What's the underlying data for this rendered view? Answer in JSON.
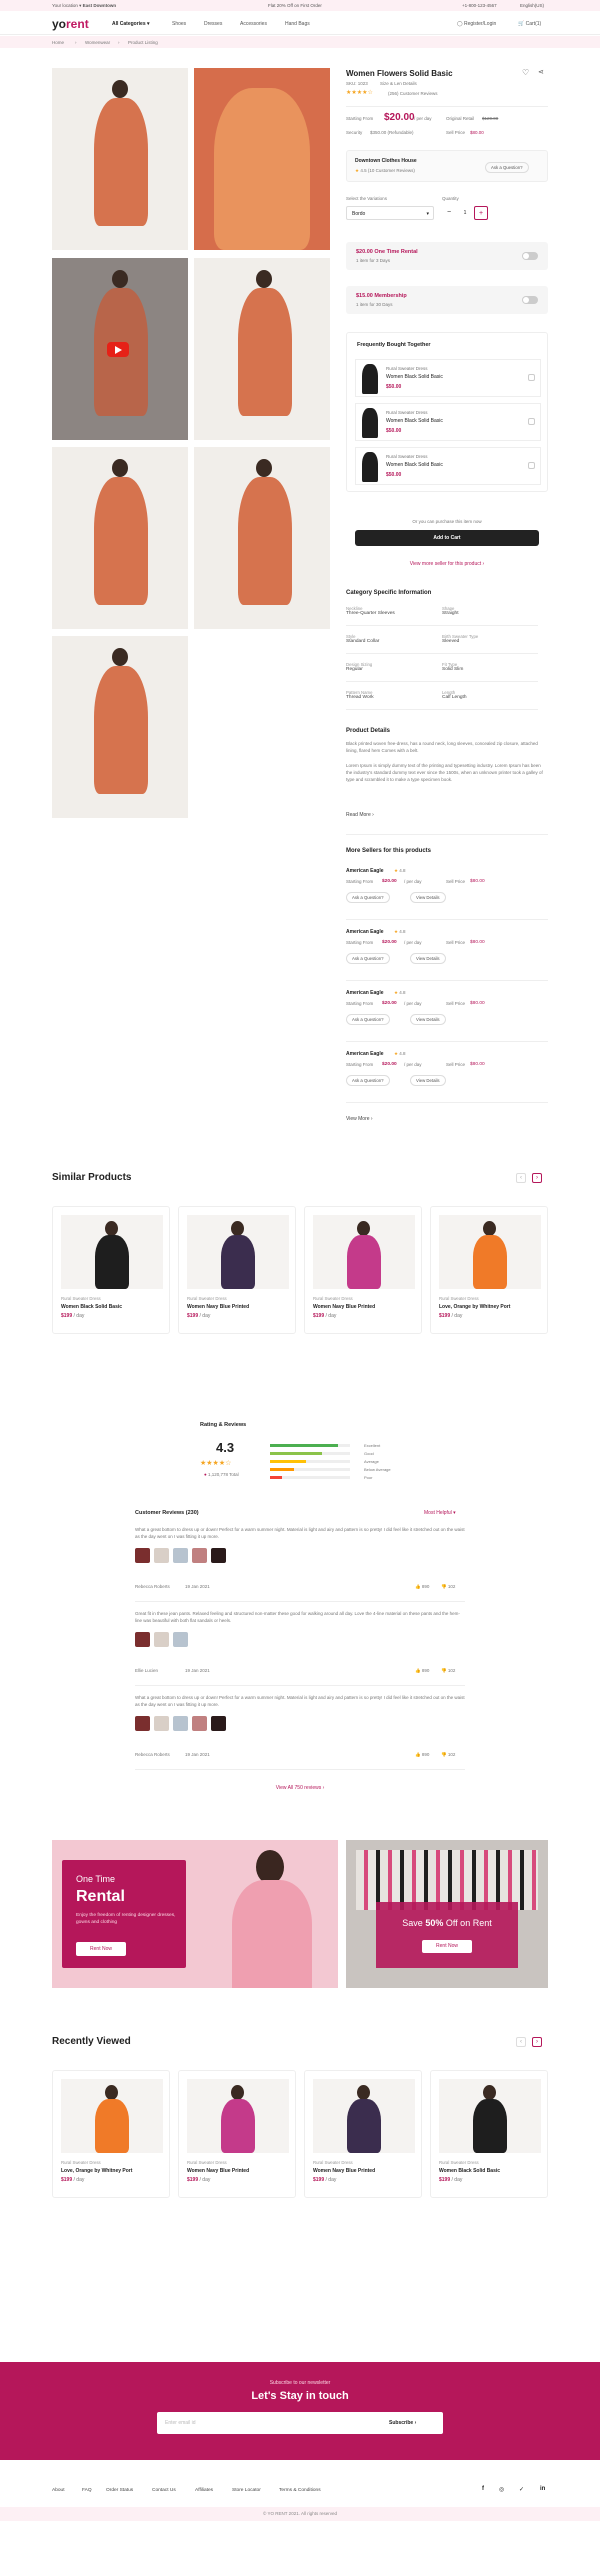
{
  "topbar": {
    "location_label": "Your location",
    "location_value": "East Downtown",
    "promo": "Flat 20% Off on First Order",
    "phone": "+1-800-123-4567",
    "language": "English(US)"
  },
  "header": {
    "logo_a": "yo",
    "logo_b": "rent",
    "categories_label": "All Categories",
    "nav": [
      "Shoes",
      "Dresses",
      "Accessories",
      "Hand Bags"
    ],
    "account": "Register/Login",
    "cart": "Cart(1)"
  },
  "breadcrumb": [
    "Home",
    "Womenwear",
    "Product Listing"
  ],
  "product": {
    "title": "Women Flowers Solid Basic",
    "sku": "SKU: 1023",
    "size": "Size & Len Details",
    "reviews": "(256) Customer Reviews",
    "starting_label": "Starting From",
    "price": "$20.00",
    "per": "/ per day",
    "retail_label": "Original Retail",
    "retail": "$120.00",
    "security_label": "Security",
    "security": "$350.00 (Refundable)",
    "sell_label": "Sell Price",
    "sell": "$80.00",
    "shop_name": "Downtown Clothes House",
    "shop_rating": "4.5 (10 Customer Reviews)",
    "ask": "Ask a Question?",
    "variation_label": "Select the Variations",
    "variation_value": "Bordo",
    "quantity_label": "Quantity",
    "quantity": "1",
    "rental_title": "$20.00 One Time Rental",
    "rental_sub": "1 item for 3 Days",
    "member_title": "$15.00 Membership",
    "member_sub": "1 item for 30 Days",
    "fbt_title": "Frequently Bought Together",
    "fbt": [
      {
        "shop": "Rural Sweater Dress",
        "name": "Women Black Solid Basic",
        "price": "$50.00"
      },
      {
        "shop": "Rural Sweater Dress",
        "name": "Women Black Solid Basic",
        "price": "$50.00"
      },
      {
        "shop": "Rural Sweater Dress",
        "name": "Women Black Solid Basic",
        "price": "$50.00"
      }
    ],
    "purchase_note": "Or you can purchase this item now",
    "add_to_cart": "Add to Cart",
    "more_sellers_link": "View more seller for this product"
  },
  "specs": {
    "title": "Category Specific Information",
    "items": [
      {
        "label": "Neckline",
        "value": "Three-Quarter Sleeves"
      },
      {
        "label": "Shape",
        "value": "Straight"
      },
      {
        "label": "Style",
        "value": "Standard Collar"
      },
      {
        "label": "Birth Sweater Type",
        "value": "Sleeved"
      },
      {
        "label": "Design Sizing",
        "value": "Regular"
      },
      {
        "label": "Fit Type",
        "value": "Solid Slim"
      },
      {
        "label": "Pattern Name",
        "value": "Thread Work"
      },
      {
        "label": "Length",
        "value": "Calf Length"
      }
    ]
  },
  "details": {
    "title": "Product Details",
    "para1": "Black printed woven free-dress, has a round neck, long sleeves, concealed zip closure, attached lining, flared hem Comes with a belt.",
    "para2": "Lorem Ipsum is simply dummy text of the printing and typesetting industry. Lorem Ipsum has been the industry's standard dummy text ever since the 1500s, when an unknown printer took a galley of type and scrambled it to make a type specimen book.",
    "read_more": "Read More"
  },
  "sellers": {
    "title": "More Sellers for this products",
    "items": [
      {
        "name": "American Eagle",
        "rating": "4.8",
        "start_label": "Starting From",
        "start": "$20.00",
        "per": "/ per day",
        "sell_label": "Sell Price",
        "sell": "$80.00",
        "ask": "Ask a Question?",
        "details": "View Details"
      },
      {
        "name": "American Eagle",
        "rating": "4.8",
        "start_label": "Starting From",
        "start": "$20.00",
        "per": "/ per day",
        "sell_label": "Sell Price",
        "sell": "$80.00",
        "ask": "Ask a Question?",
        "details": "View Details"
      },
      {
        "name": "American Eagle",
        "rating": "4.8",
        "start_label": "Starting From",
        "start": "$20.00",
        "per": "/ per day",
        "sell_label": "Sell Price",
        "sell": "$80.00",
        "ask": "Ask a Question?",
        "details": "View Details"
      },
      {
        "name": "American Eagle",
        "rating": "4.8",
        "start_label": "Starting From",
        "start": "$20.00",
        "per": "/ per day",
        "sell_label": "Sell Price",
        "sell": "$80.00",
        "ask": "Ask a Question?",
        "details": "View Details"
      }
    ],
    "view_more": "View More"
  },
  "similar": {
    "title": "Similar Products",
    "items": [
      {
        "shop": "Rural Sweater Dress",
        "name": "Women Black Solid Basic",
        "price": "$199",
        "per": "/ day",
        "color": "#1e1e1e"
      },
      {
        "shop": "Rural Sweater Dress",
        "name": "Women Navy Blue Printed",
        "price": "$199",
        "per": "/ day",
        "color": "#3b2d4e"
      },
      {
        "shop": "Rural Sweater Dress",
        "name": "Women Navy Blue Printed",
        "price": "$199",
        "per": "/ day",
        "color": "#c43a8a"
      },
      {
        "shop": "Rural Sweater Dress",
        "name": "Love, Orange by Whitney Port",
        "price": "$199",
        "per": "/ day",
        "color": "#f07a28"
      }
    ]
  },
  "ratings": {
    "title": "Rating & Reviews",
    "score": "4.3",
    "total": "1,120,778 Total",
    "bars": [
      {
        "label": "Excellent",
        "fill": 0.85,
        "color": "#4caf50"
      },
      {
        "label": "Good",
        "fill": 0.65,
        "color": "#8bc34a"
      },
      {
        "label": "Average",
        "fill": 0.45,
        "color": "#ffc107"
      },
      {
        "label": "Below Average",
        "fill": 0.3,
        "color": "#ff9800"
      },
      {
        "label": "Poor",
        "fill": 0.15,
        "color": "#f44336"
      }
    ]
  },
  "reviews": {
    "title": "Customer Reviews (230)",
    "most_helpful": "Most Helpful",
    "items": [
      {
        "text": "What a great bottom to dress up or down! Perfect for a warm summer night. Material is light and airy and pattern is so pretty! I did feel like it stretched out on the waist as the day went on I was fitting it up more.",
        "author": "Rebecca Roberts",
        "date": "19 Jan 2021",
        "likes": "890",
        "dislikes": "102"
      },
      {
        "text": "Great fit in these jean pants. Relaxed feeling and structured non-matter these good for walking around all day. Love the 4-line material on these pants and the hem-line was beautiful with both flat sandals or heels.",
        "author": "Ellie Lucien",
        "date": "19 Jan 2021",
        "likes": "890",
        "dislikes": "102"
      },
      {
        "text": "What a great bottom to dress up or down! Perfect for a warm summer night. Material is light and airy and pattern is so pretty! I did feel like it stretched out on the waist as the day went on I was fitting it up more.",
        "author": "Rebecca Roberts",
        "date": "19 Jan 2021",
        "likes": "890",
        "dislikes": "102"
      }
    ],
    "view_all": "View All 750 reviews"
  },
  "promo": {
    "left_kicker": "One Time",
    "left_title": "Rental",
    "left_text": "Enjoy the freedom of renting designer dresses, gowns and clothing",
    "left_btn": "Rent Now",
    "right_pre": "Save",
    "right_pct": "50%",
    "right_post": "Off on Rent",
    "right_btn": "Rent Now"
  },
  "recent": {
    "title": "Recently Viewed",
    "items": [
      {
        "shop": "Rural Sweater Dress",
        "name": "Love, Orange by Whitney Port",
        "price": "$199",
        "per": "/ day",
        "color": "#f07a28"
      },
      {
        "shop": "Rural Sweater Dress",
        "name": "Women Navy Blue Printed",
        "price": "$199",
        "per": "/ day",
        "color": "#c43a8a"
      },
      {
        "shop": "Rural Sweater Dress",
        "name": "Women Navy Blue Printed",
        "price": "$199",
        "per": "/ day",
        "color": "#3b2d4e"
      },
      {
        "shop": "Rural Sweater Dress",
        "name": "Women Black Solid Basic",
        "price": "$199",
        "per": "/ day",
        "color": "#1e1e1e"
      }
    ]
  },
  "newsletter": {
    "kicker": "Subscribe to our newsletter",
    "title": "Let's Stay in touch",
    "placeholder": "Enter email id",
    "button": "Subscribe"
  },
  "footer": {
    "links": [
      "About",
      "FAQ",
      "Order Status",
      "Contact Us",
      "Affiliates",
      "Store Locator",
      "Terms & Conditions"
    ],
    "copyright": "© YO RENT 2021. All rights reserved"
  },
  "colors": {
    "accent": "#b5175a",
    "dark": "#222222",
    "newsletter_bg": "#b5175a"
  }
}
